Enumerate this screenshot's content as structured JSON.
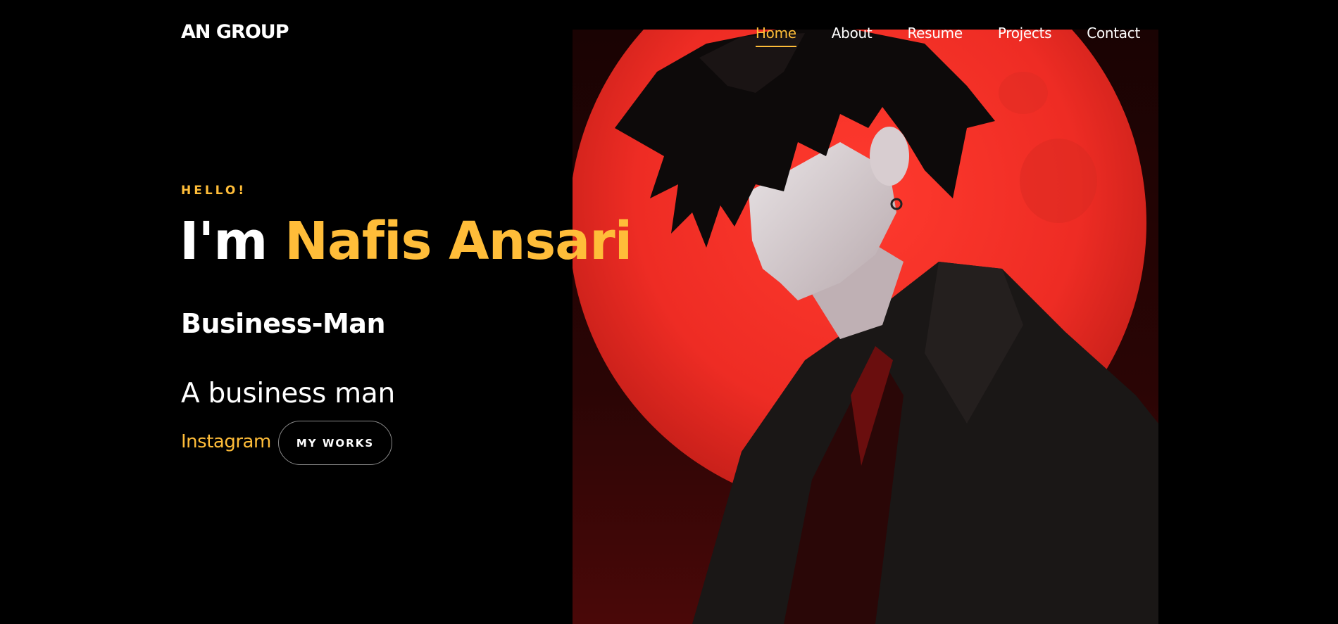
{
  "header": {
    "logo": "AN GROUP",
    "nav": [
      {
        "label": "Home",
        "active": true
      },
      {
        "label": "About",
        "active": false
      },
      {
        "label": "Resume",
        "active": false
      },
      {
        "label": "Projects",
        "active": false
      },
      {
        "label": "Contact",
        "active": false
      }
    ]
  },
  "hero": {
    "greeting": "HELLO!",
    "headline_prefix": "I'm",
    "name": "Nafis Ansari",
    "role": "Business-Man",
    "tagline": "A business man",
    "instagram_label": "Instagram",
    "works_button": "MY WORKS",
    "image_icon": "anime-man-red-moon-illustration"
  },
  "colors": {
    "accent": "#ffbd39",
    "background": "#000000",
    "text": "#ffffff",
    "moon": "#f0322a"
  }
}
